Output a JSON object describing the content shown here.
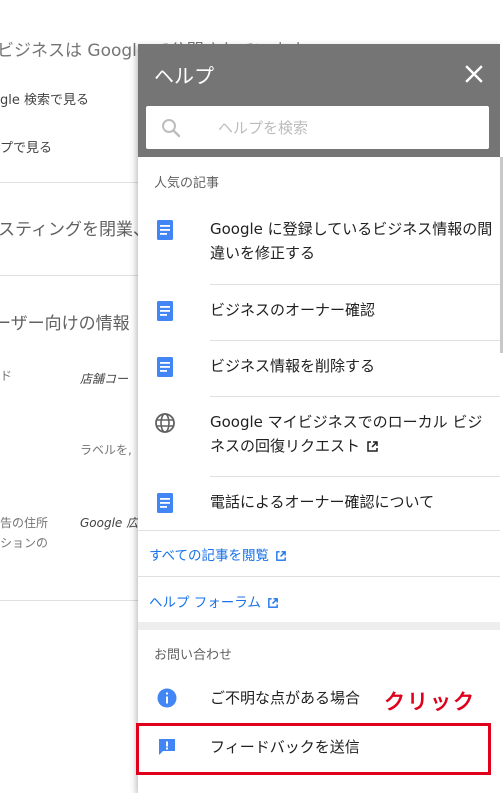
{
  "background": {
    "line1": "のビジネスは Google で公開されています",
    "line2": "gle 検索で見る",
    "line3": "プで見る",
    "line4": "スティングを閉業、",
    "line5": "ーザー向けの情報",
    "line6": "ド",
    "line7": "店舗コー",
    "line8": "ラベルを,",
    "line9": "告の住所",
    "line10": "ションの",
    "line11": "Google 広"
  },
  "panel": {
    "title": "ヘルプ",
    "search_placeholder": "ヘルプを検索",
    "popular_label": "人気の記事",
    "articles": [
      {
        "icon": "document-icon",
        "text": "Google に登録しているビジネス情報の間違いを修正する"
      },
      {
        "icon": "document-icon",
        "text": "ビジネスのオーナー確認"
      },
      {
        "icon": "document-icon",
        "text": "ビジネス情報を削除する"
      },
      {
        "icon": "globe-icon",
        "text": "Google マイビジネスでのローカル ビジネスの回復リクエスト"
      },
      {
        "icon": "document-icon",
        "text": "電話によるオーナー確認について"
      }
    ],
    "browse_all_link": "すべての記事を閲覧",
    "forum_link": "ヘルプ フォーラム",
    "contact_label": "お問い合わせ",
    "contact_items": [
      {
        "icon": "info-icon",
        "text": "ご不明な点がある場合"
      },
      {
        "icon": "feedback-icon",
        "text": "フィードバックを送信"
      }
    ]
  },
  "annotation": {
    "text": "クリック",
    "color": "#e0001b"
  },
  "colors": {
    "header": "#757575",
    "link": "#1a73e8",
    "doc_icon": "#4285f4",
    "highlight": "#e0001b"
  }
}
